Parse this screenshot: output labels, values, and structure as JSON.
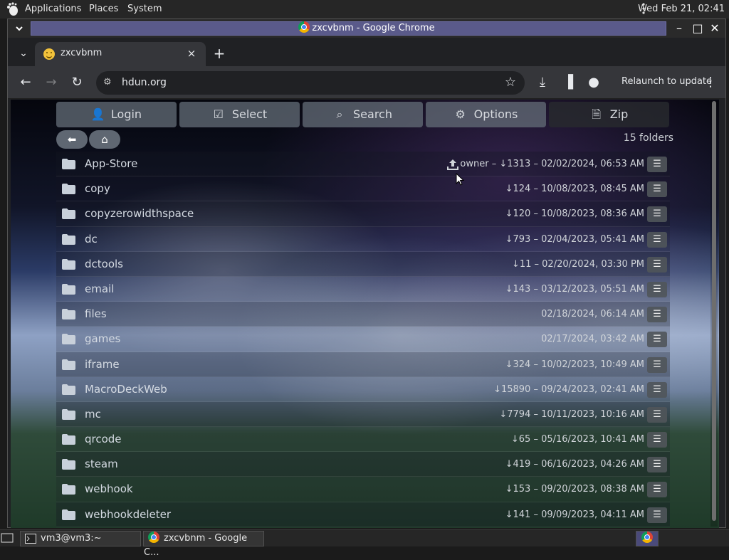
{
  "top_panel": {
    "menus": [
      "Applications",
      "Places",
      "System"
    ],
    "clock": "Wed Feb 21, 02:41"
  },
  "window": {
    "title": "zxcvbnm - Google Chrome"
  },
  "tab": {
    "title": "zxcvbnm",
    "close": "×",
    "new_tab": "+"
  },
  "toolbar": {
    "url": "hdun.org",
    "relaunch": "Relaunch to update"
  },
  "page": {
    "buttons": [
      {
        "label": "Login",
        "icon": "user-icon"
      },
      {
        "label": "Select",
        "icon": "checkbox-icon"
      },
      {
        "label": "Search",
        "icon": "search-icon"
      },
      {
        "label": "Options",
        "icon": "gear-icon"
      },
      {
        "label": "Zip",
        "icon": "zip-file-icon"
      }
    ],
    "folder_count": "15 folders",
    "folders": [
      {
        "name": "App-Store",
        "meta": "owner – ↓1313 – 02/02/2024, 06:53 AM"
      },
      {
        "name": "copy",
        "meta": "↓124 – 10/08/2023, 08:45 AM"
      },
      {
        "name": "copyzerowidthspace",
        "meta": "↓120 – 10/08/2023, 08:36 AM"
      },
      {
        "name": "dc",
        "meta": "↓793 – 02/04/2023, 05:41 AM"
      },
      {
        "name": "dctools",
        "meta": "↓11 – 02/20/2024, 03:30 PM"
      },
      {
        "name": "email",
        "meta": "↓143 – 03/12/2023, 05:51 AM"
      },
      {
        "name": "files",
        "meta": "02/18/2024, 06:14 AM"
      },
      {
        "name": "games",
        "meta": "02/17/2024, 03:42 AM"
      },
      {
        "name": "iframe",
        "meta": "↓324 – 10/02/2023, 10:49 AM"
      },
      {
        "name": "MacroDeckWeb",
        "meta": "↓15890 – 09/24/2023, 02:41 AM"
      },
      {
        "name": "mc",
        "meta": "↓7794 – 10/11/2023, 10:16 AM"
      },
      {
        "name": "qrcode",
        "meta": "↓65 – 05/16/2023, 10:41 AM"
      },
      {
        "name": "steam",
        "meta": "↓419 – 06/16/2023, 04:26 AM"
      },
      {
        "name": "webhook",
        "meta": "↓153 – 09/20/2023, 08:38 AM"
      },
      {
        "name": "webhookdeleter",
        "meta": "↓141 – 09/09/2023, 04:11 AM"
      }
    ]
  },
  "taskbar": {
    "terminal": "vm3@vm3:~",
    "chrome": "zxcvbnm - Google C..."
  }
}
